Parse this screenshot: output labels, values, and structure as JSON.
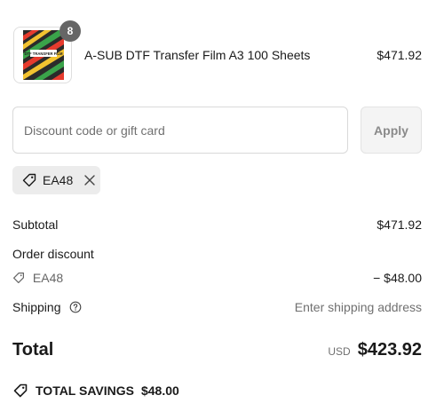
{
  "line_item": {
    "quantity": "8",
    "name": "A-SUB DTF Transfer Film A3 100 Sheets",
    "price": "$471.92",
    "thumbnail_text": "DTF TRANSFER FILM"
  },
  "discount": {
    "placeholder": "Discount code or gift card",
    "apply_label": "Apply",
    "applied_code": "EA48"
  },
  "summary": {
    "subtotal_label": "Subtotal",
    "subtotal_value": "$471.92",
    "order_discount_label": "Order discount",
    "discount_code": "EA48",
    "discount_value": "− $48.00",
    "shipping_label": "Shipping",
    "shipping_value": "Enter shipping address",
    "total_label": "Total",
    "currency": "USD",
    "total_value": "$423.92"
  },
  "savings": {
    "label": "TOTAL SAVINGS",
    "amount": "$48.00"
  },
  "icons": {
    "tag": "tag-icon",
    "remove": "close-icon",
    "help": "question-circle-icon"
  }
}
